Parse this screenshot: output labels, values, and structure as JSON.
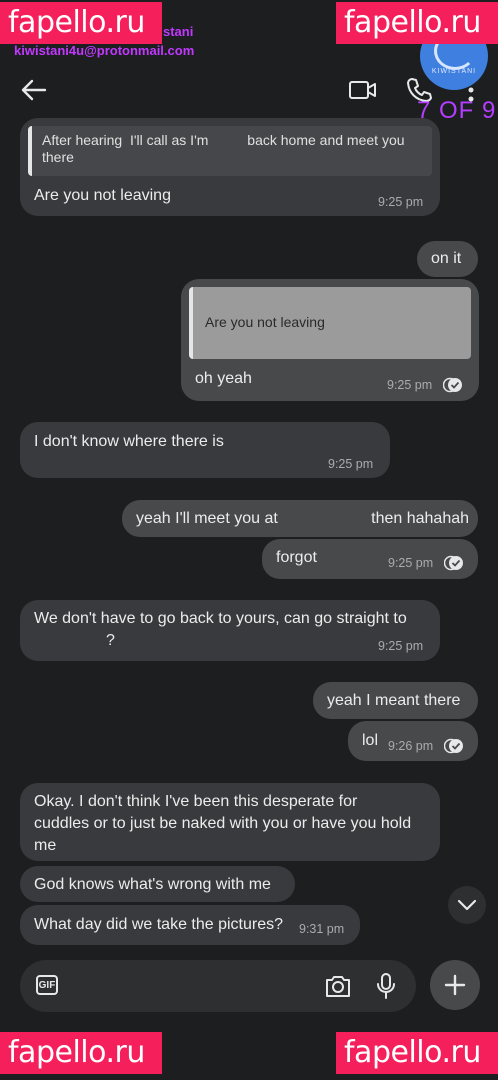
{
  "watermark": {
    "text": "fapello.ru"
  },
  "overlay": {
    "name_partial": "…stani",
    "email": "kiwistani4u@protonmail.com",
    "logo_text": "KIWISTANI",
    "counter": "7 OF 9"
  },
  "header": {
    "icons": {
      "back": "back-arrow-icon",
      "video": "video-call-icon",
      "phone": "phone-call-icon",
      "more": "more-vertical-icon"
    }
  },
  "messages": [
    {
      "quote": "After hearing  I'll call as I'm          back home and meet you there",
      "text": "Are you not leaving",
      "time": "9:25 pm"
    },
    {
      "text": "on it"
    },
    {
      "quote": "Are you not leaving",
      "text": "oh yeah",
      "time": "9:25 pm"
    },
    {
      "text": "I don't know where there is",
      "time": "9:25 pm"
    },
    {
      "text": "yeah I'll meet you at                     then hahahah"
    },
    {
      "text": "forgot",
      "time": "9:25 pm"
    },
    {
      "line1": "We don't have to go back to yours, can go straight to",
      "line2": "?",
      "time": "9:25 pm"
    },
    {
      "text": "yeah I meant there"
    },
    {
      "text": "lol",
      "time": "9:26 pm"
    },
    {
      "line1": "Okay. I don't think I've been this desperate for",
      "line2": "cuddles or to just be naked with you or have you hold",
      "line3": "me"
    },
    {
      "text": "God knows what's wrong with me"
    },
    {
      "text": "What day did we take the pictures?",
      "time": "9:31 pm"
    }
  ],
  "composer": {
    "gif_label": "GIF",
    "icons": {
      "camera": "camera-icon",
      "mic": "microphone-icon",
      "plus": "plus-icon",
      "scroll": "chevron-down-icon"
    }
  }
}
